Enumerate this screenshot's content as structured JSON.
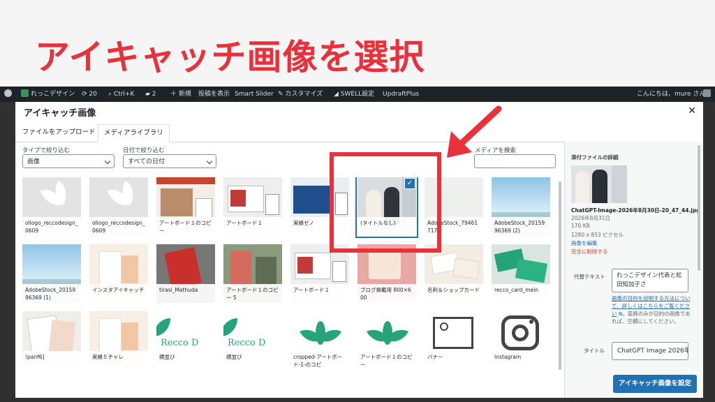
{
  "banner": {
    "title": "アイキャッチ画像を選択",
    "color": "#e8313a"
  },
  "adminbar": {
    "site_name": "れっこデザイン",
    "updates": "20",
    "shortcut": "Ctrl+K",
    "comments": "2",
    "new": "＋ 新規",
    "view_post": "投稿を表示",
    "smart_slider": "Smart Slider",
    "customize": "カスタマイズ",
    "swell": "SWELL設定",
    "updraft": "UpdraftPlus",
    "greeting": "こんにちは、mure さん"
  },
  "modal": {
    "title": "アイキャッチ画像",
    "tabs": [
      "ファイルをアップロード",
      "メディアライブラリ"
    ],
    "active_tab": 1,
    "filter_type_label": "タイプで絞り込む",
    "filter_type_value": "画像",
    "filter_date_label": "日付で絞り込む",
    "filter_date_value": "すべての日付",
    "search_label": "メディアを検索",
    "items": [
      {
        "caption": "ollogo_reccodesign_0609",
        "kind": "leaf"
      },
      {
        "caption": "ollogo_reccodesign_0609",
        "kind": "leaf"
      },
      {
        "caption": "アートボード１のコピー",
        "kind": "photo-warm"
      },
      {
        "caption": "アートボード１",
        "kind": "photo-red"
      },
      {
        "caption": "実績ゼノ",
        "kind": "screen-blue"
      },
      {
        "caption": "(タイトルなし)",
        "kind": "photo-people",
        "selected": true
      },
      {
        "caption": "AdobeStock_794617176",
        "kind": "plain-light"
      },
      {
        "caption": "AdobeStock_2015996369 (2)",
        "kind": "sky"
      },
      {
        "caption": "AdobeStock_2015996369 (1)",
        "kind": "sky"
      },
      {
        "caption": "インスタアイキャッチ",
        "kind": "paper"
      },
      {
        "caption": "tirasi_Mathuda",
        "kind": "flyer"
      },
      {
        "caption": "アートボード１のコピー 5",
        "kind": "photo-green"
      },
      {
        "caption": "アートボード１",
        "kind": "photo-red"
      },
      {
        "caption": "ブログ掲載用 800×600",
        "kind": "pink"
      },
      {
        "caption": "名刺＆ショップカード",
        "kind": "cards-cream"
      },
      {
        "caption": "recco_card_mein",
        "kind": "cards-green"
      },
      {
        "caption": "!panf6]",
        "kind": "flyer-light"
      },
      {
        "caption": "実績５チャレ",
        "kind": "paper"
      },
      {
        "caption": "横並び",
        "kind": "recco"
      },
      {
        "caption": "横並び",
        "kind": "recco"
      },
      {
        "caption": "cropped-アートボード-1-のコピ",
        "kind": "leaf-green"
      },
      {
        "caption": "アートボード１のコピー",
        "kind": "leaf-green"
      },
      {
        "caption": "バナー",
        "kind": "placeholder"
      },
      {
        "caption": "Instagram",
        "kind": "instagram"
      }
    ],
    "recco_text": "Recco D",
    "sidebar": {
      "heading": "添付ファイルの詳細",
      "filename": "ChatGPT-Image-2026年8月30日-20_47_44.jpg",
      "date": "2026年8月31日",
      "size": "170 KB",
      "dimensions": "1280 x 853 ピクセル",
      "edit_link": "画像を編集",
      "delete_link": "完全に削除する",
      "alt_label": "代替テキスト",
      "alt_value": "れっこデザイン代表と松田知加子さ",
      "alt_help_link": "画像の目的を説明する方法について、詳しくはこちらをご覧ください",
      "alt_help_text": "。装飾のみが目的の画像であれば、空欄にしてください。",
      "title_label": "タイトル",
      "title_value": "ChatGPT Image 2026年"
    },
    "primary_button": "アイキャッチ画像を設定",
    "accent": "#2271b1"
  }
}
